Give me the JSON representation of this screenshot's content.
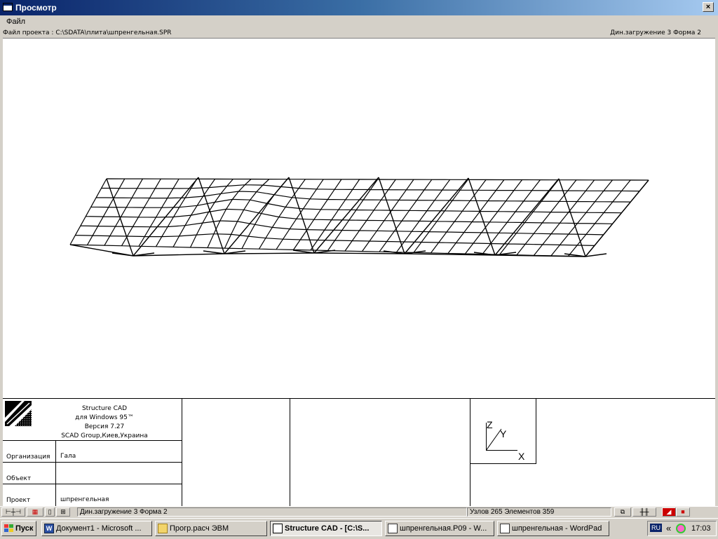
{
  "window": {
    "title": "Просмотр",
    "close_glyph": "×"
  },
  "menu": {
    "file": "Файл"
  },
  "info": {
    "project_file": "Файл проекта : C:\\SDATA\\плита\\шпренгельная.SPR",
    "load_case": "Дин.загружение 3  Форма 2"
  },
  "stamp": {
    "program_lines": [
      "Structure CAD",
      "для Windows 95™",
      "Версия 7.27",
      "SCAD Group,Киев,Украина"
    ],
    "org_label": "Организация",
    "org_value": "Гала",
    "object_label": "Объект",
    "object_value": "",
    "project_label": "Проект",
    "project_value": "шпренгельная",
    "axes": {
      "z": "Z",
      "y": "Y",
      "x": "X"
    }
  },
  "status": {
    "load_case": "Дин.загружение 3  Форма 2",
    "counts": "Узлов 265 Элементов 359"
  },
  "taskbar": {
    "start": "Пуск",
    "tasks": [
      {
        "label": "Документ1 - Microsoft ...",
        "icon": "word-icon"
      },
      {
        "label": "Прогр.расч ЭВМ",
        "icon": "folder-icon"
      },
      {
        "label": "Structure CAD  - [C:\\S...",
        "icon": "scad-icon",
        "active": true
      },
      {
        "label": "шпренгельная.P09 - W...",
        "icon": "wordpad-icon"
      },
      {
        "label": "шпренгельная - WordPad",
        "icon": "wordpad-icon"
      }
    ],
    "lang": "RU",
    "tray_arrows": "«",
    "clock": "17:03"
  },
  "colors": {
    "title_start": "#0a246a",
    "title_end": "#a6caf0",
    "face": "#d4d0c8"
  }
}
